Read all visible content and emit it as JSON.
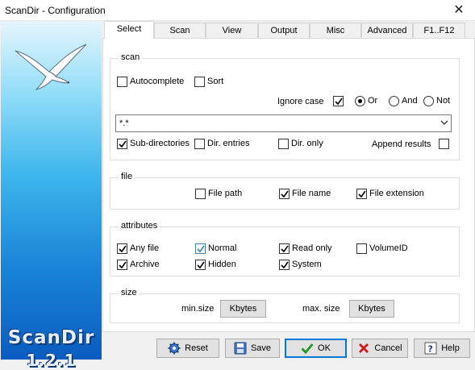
{
  "window": {
    "title": "ScanDir - Configuration",
    "close_glyph": "✕"
  },
  "brand": {
    "name": "ScanDir",
    "version": "1.2.1"
  },
  "tabs": [
    {
      "label": "Select",
      "active": true
    },
    {
      "label": "Scan"
    },
    {
      "label": "View"
    },
    {
      "label": "Output"
    },
    {
      "label": "Misc"
    },
    {
      "label": "Advanced"
    },
    {
      "label": "F1..F12"
    }
  ],
  "scan": {
    "legend": "scan",
    "autocomplete": {
      "label": "Autocomplete",
      "checked": false
    },
    "sort": {
      "label": "Sort",
      "checked": false
    },
    "ignore_case": {
      "label": "Ignore case",
      "checked": true
    },
    "mode": {
      "or": "Or",
      "and": "And",
      "not": "Not",
      "selected": "Or"
    },
    "pattern": "*.*",
    "sub_directories": {
      "label": "Sub-directories",
      "checked": true
    },
    "dir_entries": {
      "label": "Dir. entries",
      "checked": false
    },
    "dir_only": {
      "label": "Dir. only",
      "checked": false
    },
    "append_results": {
      "label": "Append results",
      "checked": false
    }
  },
  "file": {
    "legend": "file",
    "file_path": {
      "label": "File path",
      "checked": false
    },
    "file_name": {
      "label": "File name",
      "checked": true
    },
    "file_extension": {
      "label": "File extension",
      "checked": true
    }
  },
  "attributes": {
    "legend": "attributes",
    "any_file": {
      "label": "Any file",
      "checked": true
    },
    "normal": {
      "label": "Normal",
      "checked": true
    },
    "read_only": {
      "label": "Read only",
      "checked": true
    },
    "volume_id": {
      "label": "VolumeID",
      "checked": false
    },
    "archive": {
      "label": "Archive",
      "checked": true
    },
    "hidden": {
      "label": "Hidden",
      "checked": true
    },
    "system": {
      "label": "System",
      "checked": true
    }
  },
  "size": {
    "legend": "size",
    "min_label": "min.size",
    "min_unit": "Kbytes",
    "max_label": "max. size",
    "max_unit": "Kbytes"
  },
  "buttons": {
    "reset": "Reset",
    "save": "Save",
    "ok": "OK",
    "cancel": "Cancel",
    "help": "Help"
  },
  "colors": {
    "accent": "#0078d7",
    "check_blue": "#3c7fb1",
    "ok_green": "#1a9a1a",
    "cancel_red": "#d01a1a"
  }
}
